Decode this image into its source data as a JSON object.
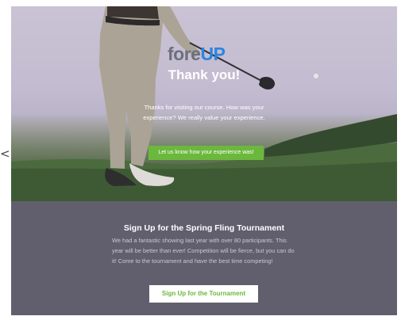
{
  "stray_mark": "<",
  "logo": {
    "part_fore": "fore",
    "part_up": "UP",
    "colors": {
      "fore": "#6c6f7d",
      "up": "#2b85e0"
    }
  },
  "hero": {
    "title": "Thank you!",
    "message": "Thanks for visiting our course. How was your experience? We really value your experience.",
    "feedback_button": "Let us know how your experience was!",
    "image": "golfer-swinging-club-photo"
  },
  "tournament": {
    "title": "Sign Up for the Spring Fling Tournament",
    "description": "We had a fantastic showing last year with over 80 participants. This year will be better than ever! Competition will be fierce, but you can do it! Come to the tournament and have the best time competing!",
    "signup_button": "Sign Up for the Tournament"
  },
  "colors": {
    "accent_green": "#6bb83d",
    "panel_background": "#615f6e",
    "brand_blue": "#2b85e0"
  }
}
